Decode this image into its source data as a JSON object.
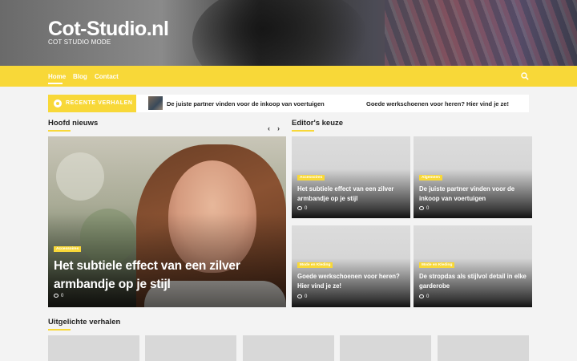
{
  "header": {
    "site_title": "Cot-Studio.nl",
    "tagline": "COT STUDIO MODE"
  },
  "nav": {
    "items": [
      {
        "label": "Home",
        "active": true
      },
      {
        "label": "Blog",
        "active": false
      },
      {
        "label": "Contact",
        "active": false
      }
    ],
    "search_icon": "search-icon"
  },
  "ticker": {
    "label": "RECENTE VERHALEN",
    "items": [
      "De juiste partner vinden voor de inkoop van voertuigen",
      "Goede werkschoenen voor heren? Hier vind je ze!"
    ]
  },
  "headlines": {
    "title": "Hoofd nieuws",
    "prev": "‹",
    "next": "›",
    "slide": {
      "category": "Accessoires",
      "title": "Het subtiele effect van een zilver armbandje op je stijl",
      "comments": "0"
    }
  },
  "editors": {
    "title": "Editor's keuze",
    "cards": [
      {
        "category": "Accessoires",
        "title": "Het subtiele effect van een zilver armbandje op je stijl",
        "comments": "0"
      },
      {
        "category": "Algemeen",
        "title": "De juiste partner vinden voor de inkoop van voertuigen",
        "comments": "0"
      },
      {
        "category": "Mode en Kleding",
        "title": "Goede werkschoenen voor heren? Hier vind je ze!",
        "comments": "0"
      },
      {
        "category": "Mode en Kleding",
        "title": "De stropdas als stijlvol detail in elke garderobe",
        "comments": "0"
      }
    ]
  },
  "featured": {
    "title": "Uitgelichte verhalen"
  },
  "colors": {
    "accent": "#f8d838",
    "background": "#f3f3f3"
  }
}
